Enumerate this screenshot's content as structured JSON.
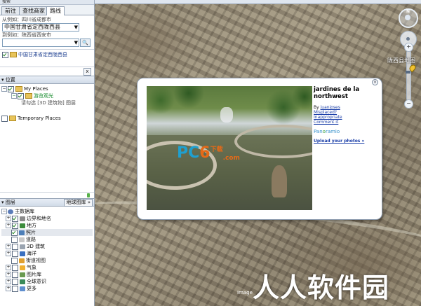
{
  "sidebar": {
    "top_label": "搜索",
    "tabs": [
      {
        "label": "前往",
        "active": false
      },
      {
        "label": "查找商家",
        "active": false
      },
      {
        "label": "路线",
        "active": true
      }
    ],
    "from_hint": "从例如：四川省成都市",
    "from_value": "中国甘肃省定西陇西县",
    "to_hint": "到例如：陕西省西安市",
    "to_value": "",
    "result_item": "中国甘肃省定西陇西县",
    "close_label": "x"
  },
  "places": {
    "header": "位置",
    "my_places": "My Places",
    "sightseeing": "游览观光",
    "sub_note": "请勾选 [3D 建筑物] 图层",
    "temporary": "Temporary Places"
  },
  "layers": {
    "header": "图层",
    "gallery_button": "地球图库 »",
    "items": [
      {
        "label": "主数据库",
        "color": "#5a7bb8"
      },
      {
        "label": "边界和地名",
        "color": "#8a8a8a"
      },
      {
        "label": "地方",
        "color": "#3c8c3c"
      },
      {
        "label": "照片",
        "color": "#4d7fb8"
      },
      {
        "label": "道路",
        "color": "#c8c8c8"
      },
      {
        "label": "3D 建筑",
        "color": "#9aa4b0"
      },
      {
        "label": "海洋",
        "color": "#3a70c0"
      },
      {
        "label": "街道视图",
        "color": "#e0a030"
      },
      {
        "label": "气象",
        "color": "#f0b030"
      },
      {
        "label": "图片库",
        "color": "#6a9a50"
      },
      {
        "label": "全球意识",
        "color": "#3a8a5a"
      },
      {
        "label": "更多",
        "color": "#5f8fcf"
      }
    ]
  },
  "map": {
    "place_label": "陇西县地图",
    "north": "N"
  },
  "popup": {
    "title": "jardines de la northwest",
    "by_label": "By",
    "author": "juanjoses",
    "link_misplaced": "Misplaced?",
    "link_inappropriate": "Inappropriate",
    "link_comment": "Comment it",
    "panoramio_a": "Pan",
    "panoramio_o": "o",
    "panoramio_b": "ramio",
    "upload": "Upload your photos »",
    "close": "×",
    "watermark_pc": "PC",
    "watermark_6": "6",
    "watermark_dl": "下载",
    "watermark_com": ".com"
  },
  "watermark": {
    "text": "人人软件园",
    "credit": "Image"
  }
}
